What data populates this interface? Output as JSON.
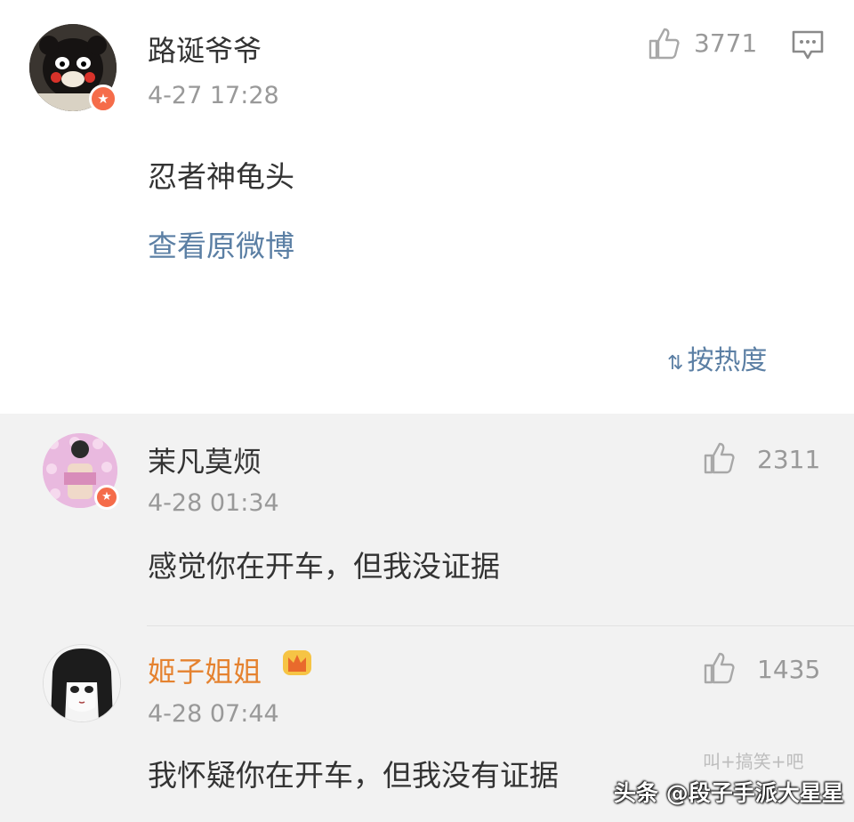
{
  "post": {
    "author": "路诞爷爷",
    "time": "4-27 17:28",
    "text": "忍者神龟头",
    "view_original": "查看原微博",
    "likes": "3771",
    "sort_label": "按热度"
  },
  "comments": [
    {
      "author": "茉凡莫烦",
      "time": "4-28 01:34",
      "text": "感觉你在开车，但我没证据",
      "likes": "2311"
    },
    {
      "author": "姬子姐姐",
      "author_color": "#e5822f",
      "time": "4-28 07:44",
      "text": "我怀疑你在开车，但我没有证据",
      "likes": "1435"
    }
  ],
  "watermark": {
    "text": "头条 @段子手派大星星",
    "faint_text": "叫+搞笑+吧"
  },
  "icons": {
    "like": "thumbs-up-icon",
    "comment": "comment-icon",
    "sort": "sort-icon",
    "badge": "verified-badge-icon",
    "crown": "vip-crown-icon"
  }
}
